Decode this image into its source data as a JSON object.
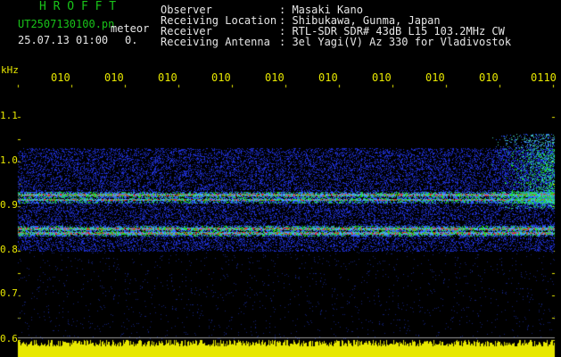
{
  "header": {
    "app_title": "H R O F F T",
    "file_name": "UT2507130100.pn",
    "type_label": "meteor",
    "datetime": "25.07.13 01:00",
    "extra": "0.",
    "labels": [
      "Observer",
      "Receiving Location",
      "Receiver",
      "Receiving Antenna"
    ],
    "values": [
      ": Masaki Kano",
      ": Shibukawa, Gunma, Japan",
      ": RTL-SDR SDR# 43dB L15 103.2MHz CW",
      ": 3el Yagi(V) Az 330 for Vladivostok"
    ]
  },
  "axis": {
    "unit": "kHz",
    "y_ticks": [
      "1.1",
      "1.0",
      "0.9",
      "0.8",
      "0.7",
      "0.6"
    ],
    "x_ticks": [
      "010",
      "010",
      "010",
      "010",
      "010",
      "010",
      "010",
      "010",
      "010",
      "0110"
    ]
  },
  "colors": {
    "background": "#000000",
    "noise": "#1e2fd0",
    "band": "#20e020",
    "hot": "#e02a2a",
    "amplitude": "#e8e800",
    "grid_text": "#e8e800",
    "title": "#19c419"
  },
  "chart_data": {
    "type": "heatmap",
    "ylabel": "kHz",
    "ylim": [
      0.6,
      1.15
    ],
    "signal_lines_khz": [
      0.915,
      0.925,
      0.84,
      0.85
    ],
    "noise_band_khz": [
      0.8,
      1.03
    ],
    "meteor_burst_x_fraction": [
      0.88,
      1.0
    ]
  }
}
